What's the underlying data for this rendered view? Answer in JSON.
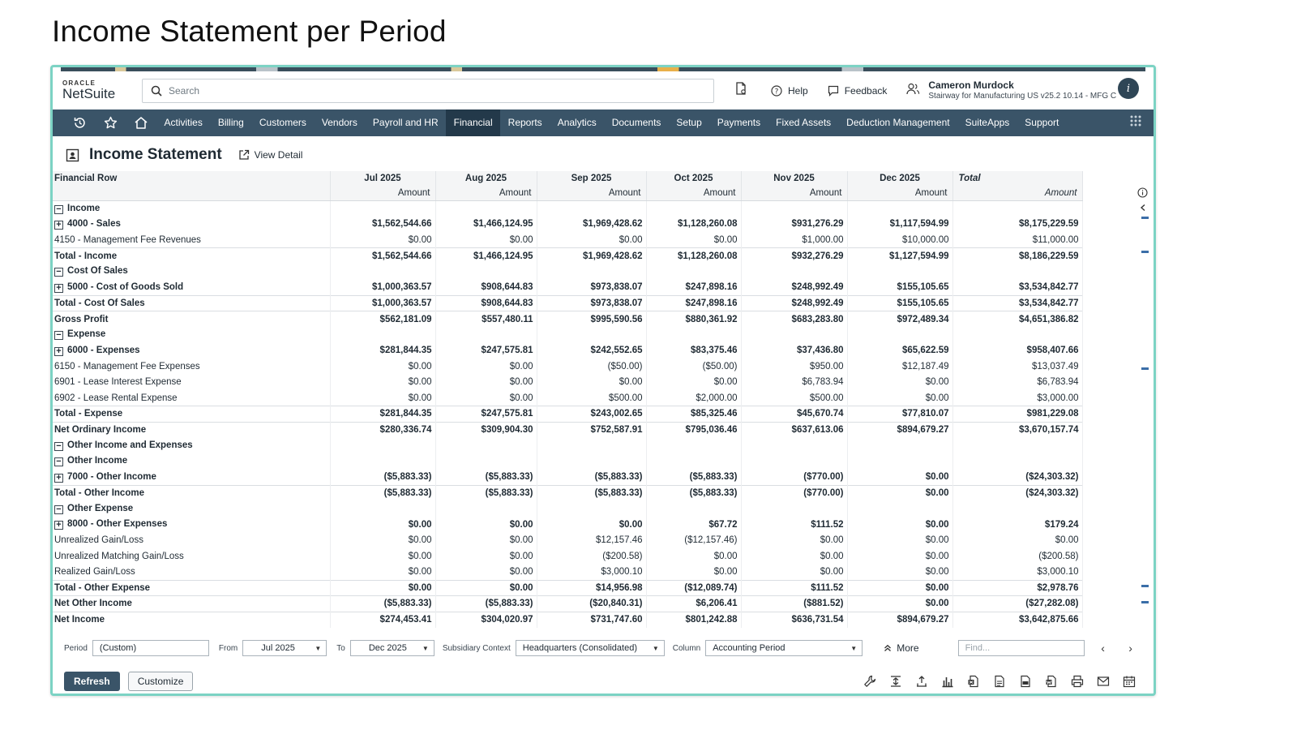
{
  "slide": {
    "title": "Income Statement per Period"
  },
  "brand": {
    "oracle": "ORACLE",
    "netsuite": "NetSuite",
    "nav_color": "#3a5468",
    "frame_color": "#7cd3c4"
  },
  "topbar": {
    "search_placeholder": "Search",
    "help_label": "Help",
    "feedback_label": "Feedback",
    "user_name": "Cameron Murdock",
    "user_account": "Stairway for Manufacturing US v25.2 10.14 - MFG C",
    "user_badge": "i"
  },
  "nav": {
    "items": [
      "Activities",
      "Billing",
      "Customers",
      "Vendors",
      "Payroll and HR",
      "Financial",
      "Reports",
      "Analytics",
      "Documents",
      "Setup",
      "Payments",
      "Fixed Assets",
      "Deduction Management",
      "SuiteApps",
      "Support"
    ],
    "active": "Financial"
  },
  "page": {
    "title": "Income Statement",
    "view_detail": "View Detail"
  },
  "table": {
    "row_header": "Financial Row",
    "periods": [
      "Jul 2025",
      "Aug 2025",
      "Sep 2025",
      "Oct 2025",
      "Nov 2025",
      "Dec 2025",
      "Total"
    ],
    "sub_header": "Amount",
    "rows": [
      {
        "label": "Income",
        "level": 1,
        "toggle": "minus",
        "bold": true,
        "values": [
          "",
          "",
          "",
          "",
          "",
          "",
          ""
        ]
      },
      {
        "label": "4000 - Sales",
        "level": 2,
        "toggle": "plus",
        "bold": true,
        "values": [
          "$1,562,544.66",
          "$1,466,124.95",
          "$1,969,428.62",
          "$1,128,260.08",
          "$931,276.29",
          "$1,117,594.99",
          "$8,175,229.59"
        ]
      },
      {
        "label": "4150 - Management Fee Revenues",
        "level": 3,
        "toggle": "",
        "bold": false,
        "values": [
          "$0.00",
          "$0.00",
          "$0.00",
          "$0.00",
          "$1,000.00",
          "$10,000.00",
          "$11,000.00"
        ]
      },
      {
        "label": "Total - Income",
        "level": 2,
        "toggle": "",
        "bold": true,
        "line": true,
        "values": [
          "$1,562,544.66",
          "$1,466,124.95",
          "$1,969,428.62",
          "$1,128,260.08",
          "$932,276.29",
          "$1,127,594.99",
          "$8,186,229.59"
        ]
      },
      {
        "label": "Cost Of Sales",
        "level": 1,
        "toggle": "minus",
        "bold": true,
        "values": [
          "",
          "",
          "",
          "",
          "",
          "",
          ""
        ]
      },
      {
        "label": "5000 - Cost of Goods Sold",
        "level": 2,
        "toggle": "plus",
        "bold": true,
        "values": [
          "$1,000,363.57",
          "$908,644.83",
          "$973,838.07",
          "$247,898.16",
          "$248,992.49",
          "$155,105.65",
          "$3,534,842.77"
        ]
      },
      {
        "label": "Total - Cost Of Sales",
        "level": 2,
        "toggle": "",
        "bold": true,
        "line": true,
        "values": [
          "$1,000,363.57",
          "$908,644.83",
          "$973,838.07",
          "$247,898.16",
          "$248,992.49",
          "$155,105.65",
          "$3,534,842.77"
        ]
      },
      {
        "label": "Gross Profit",
        "level": 2,
        "toggle": "",
        "bold": true,
        "line": true,
        "values": [
          "$562,181.09",
          "$557,480.11",
          "$995,590.56",
          "$880,361.92",
          "$683,283.80",
          "$972,489.34",
          "$4,651,386.82"
        ]
      },
      {
        "label": "Expense",
        "level": 1,
        "toggle": "minus",
        "bold": true,
        "values": [
          "",
          "",
          "",
          "",
          "",
          "",
          ""
        ]
      },
      {
        "label": "6000 - Expenses",
        "level": 2,
        "toggle": "plus",
        "bold": true,
        "values": [
          "$281,844.35",
          "$247,575.81",
          "$242,552.65",
          "$83,375.46",
          "$37,436.80",
          "$65,622.59",
          "$958,407.66"
        ]
      },
      {
        "label": "6150 - Management Fee Expenses",
        "level": 3,
        "toggle": "",
        "bold": false,
        "values": [
          "$0.00",
          "$0.00",
          "($50.00)",
          "($50.00)",
          "$950.00",
          "$12,187.49",
          "$13,037.49"
        ]
      },
      {
        "label": "6901 - Lease Interest Expense",
        "level": 3,
        "toggle": "",
        "bold": false,
        "values": [
          "$0.00",
          "$0.00",
          "$0.00",
          "$0.00",
          "$6,783.94",
          "$0.00",
          "$6,783.94"
        ]
      },
      {
        "label": "6902 - Lease Rental Expense",
        "level": 3,
        "toggle": "",
        "bold": false,
        "values": [
          "$0.00",
          "$0.00",
          "$500.00",
          "$2,000.00",
          "$500.00",
          "$0.00",
          "$3,000.00"
        ]
      },
      {
        "label": "Total - Expense",
        "level": 2,
        "toggle": "",
        "bold": true,
        "line": true,
        "values": [
          "$281,844.35",
          "$247,575.81",
          "$243,002.65",
          "$85,325.46",
          "$45,670.74",
          "$77,810.07",
          "$981,229.08"
        ]
      },
      {
        "label": "Net Ordinary Income",
        "level": 1,
        "toggle": "",
        "bold": true,
        "line": true,
        "values": [
          "$280,336.74",
          "$309,904.30",
          "$752,587.91",
          "$795,036.46",
          "$637,613.06",
          "$894,679.27",
          "$3,670,157.74"
        ]
      },
      {
        "label": "Other Income and Expenses",
        "level": 0,
        "toggle": "minus",
        "bold": true,
        "values": [
          "",
          "",
          "",
          "",
          "",
          "",
          ""
        ]
      },
      {
        "label": "Other Income",
        "level": 1,
        "toggle": "minus",
        "bold": true,
        "values": [
          "",
          "",
          "",
          "",
          "",
          "",
          ""
        ]
      },
      {
        "label": "7000 - Other Income",
        "level": 2,
        "toggle": "plus",
        "bold": true,
        "values": [
          "($5,883.33)",
          "($5,883.33)",
          "($5,883.33)",
          "($5,883.33)",
          "($770.00)",
          "$0.00",
          "($24,303.32)"
        ]
      },
      {
        "label": "Total - Other Income",
        "level": 2,
        "toggle": "",
        "bold": true,
        "line": true,
        "values": [
          "($5,883.33)",
          "($5,883.33)",
          "($5,883.33)",
          "($5,883.33)",
          "($770.00)",
          "$0.00",
          "($24,303.32)"
        ]
      },
      {
        "label": "Other Expense",
        "level": 1,
        "toggle": "minus",
        "bold": true,
        "values": [
          "",
          "",
          "",
          "",
          "",
          "",
          ""
        ]
      },
      {
        "label": "8000 - Other Expenses",
        "level": 2,
        "toggle": "plus",
        "bold": true,
        "values": [
          "$0.00",
          "$0.00",
          "$0.00",
          "$67.72",
          "$111.52",
          "$0.00",
          "$179.24"
        ]
      },
      {
        "label": "Unrealized Gain/Loss",
        "level": 3,
        "toggle": "",
        "bold": false,
        "values": [
          "$0.00",
          "$0.00",
          "$12,157.46",
          "($12,157.46)",
          "$0.00",
          "$0.00",
          "$0.00"
        ]
      },
      {
        "label": "Unrealized Matching Gain/Loss",
        "level": 3,
        "toggle": "",
        "bold": false,
        "values": [
          "$0.00",
          "$0.00",
          "($200.58)",
          "$0.00",
          "$0.00",
          "$0.00",
          "($200.58)"
        ]
      },
      {
        "label": "Realized Gain/Loss",
        "level": 3,
        "toggle": "",
        "bold": false,
        "values": [
          "$0.00",
          "$0.00",
          "$3,000.10",
          "$0.00",
          "$0.00",
          "$0.00",
          "$3,000.10"
        ]
      },
      {
        "label": "Total - Other Expense",
        "level": 2,
        "toggle": "",
        "bold": true,
        "line": true,
        "values": [
          "$0.00",
          "$0.00",
          "$14,956.98",
          "($12,089.74)",
          "$111.52",
          "$0.00",
          "$2,978.76"
        ]
      },
      {
        "label": "Net Other Income",
        "level": 1,
        "toggle": "",
        "bold": true,
        "line": true,
        "values": [
          "($5,883.33)",
          "($5,883.33)",
          "($20,840.31)",
          "$6,206.41",
          "($881.52)",
          "$0.00",
          "($27,282.08)"
        ]
      },
      {
        "label": "Net Income",
        "level": 1,
        "toggle": "",
        "bold": true,
        "line": true,
        "values": [
          "$274,453.41",
          "$304,020.97",
          "$731,747.60",
          "$801,242.88",
          "$636,731.54",
          "$894,679.27",
          "$3,642,875.66"
        ]
      }
    ]
  },
  "filters": {
    "period_label": "Period",
    "period_value": "(Custom)",
    "from_label": "From",
    "from_value": "Jul 2025",
    "to_label": "To",
    "to_value": "Dec 2025",
    "subsidiary_label": "Subsidiary Context",
    "subsidiary_value": "Headquarters (Consolidated)",
    "column_label": "Column",
    "column_value": "Accounting Period",
    "more_label": "More",
    "find_placeholder": "Find..."
  },
  "actions": {
    "refresh": "Refresh",
    "customize": "Customize"
  }
}
